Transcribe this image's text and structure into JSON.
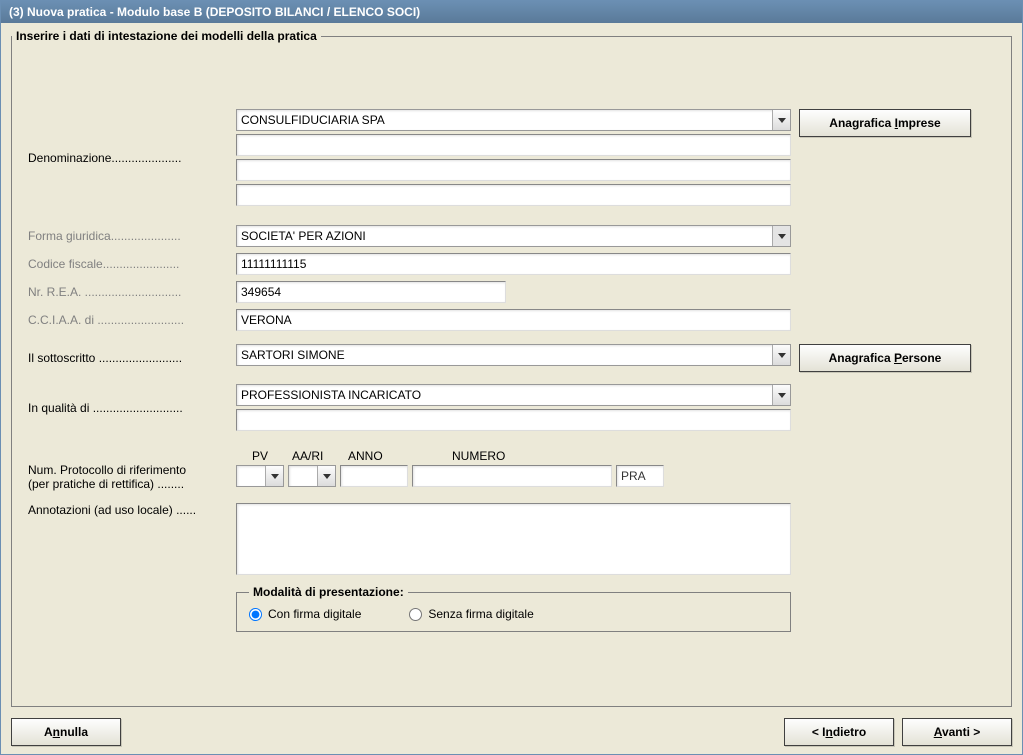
{
  "window": {
    "title": "(3) Nuova pratica - Modulo base B (DEPOSITO BILANCI / ELENCO SOCI)"
  },
  "fieldset": {
    "legend": "Inserire i dati di intestazione dei modelli della pratica"
  },
  "labels": {
    "denominazione": "Denominazione.....................",
    "forma_giuridica": "Forma giuridica.....................",
    "codice_fiscale": "Codice fiscale.......................",
    "nr_rea": "Nr. R.E.A. .............................",
    "cciaa_di": "C.C.I.A.A. di ..........................",
    "il_sottoscritto": "Il sottoscritto .........................",
    "in_qualita_di": "In qualità di ...........................",
    "num_protocollo_line1": "Num. Protocollo di riferimento",
    "num_protocollo_line2": "(per pratiche di rettifica) ........",
    "annotazioni": "Annotazioni (ad uso locale) ......"
  },
  "fields": {
    "denominazione": "CONSULFIDUCIARIA SPA",
    "denominazione2": "",
    "denominazione3": "",
    "denominazione4": "",
    "forma_giuridica": "SOCIETA' PER AZIONI",
    "codice_fiscale": "11111111115",
    "nr_rea": "349654",
    "cciaa_di": "VERONA",
    "sottoscritto": "SARTORI SIMONE",
    "in_qualita_di": "PROFESSIONISTA INCARICATO",
    "in_qualita_di_extra": "",
    "annotazioni": ""
  },
  "protocollo": {
    "headers": {
      "pv": "PV",
      "aa_ri": "AA/RI",
      "anno": "ANNO",
      "numero": "NUMERO"
    },
    "pv": "",
    "aa_ri": "",
    "anno": "",
    "numero": "",
    "suffix": "PRA"
  },
  "modalita": {
    "legend": "Modalità di presentazione:",
    "con_firma": "Con firma digitale",
    "senza_firma": "Senza firma digitale",
    "selected": "con"
  },
  "buttons": {
    "anagrafica_imprese_pre": "Anagrafica ",
    "anagrafica_imprese_ul": "I",
    "anagrafica_imprese_post": "mprese",
    "anagrafica_persone_pre": "Anagrafica ",
    "anagrafica_persone_ul": "P",
    "anagrafica_persone_post": "ersone",
    "annulla_pre": "A",
    "annulla_ul": "n",
    "annulla_post": "nulla",
    "indietro_pre": "< I",
    "indietro_ul": "n",
    "indietro_post": "dietro",
    "avanti_pre": "",
    "avanti_ul": "A",
    "avanti_post": "vanti >"
  }
}
